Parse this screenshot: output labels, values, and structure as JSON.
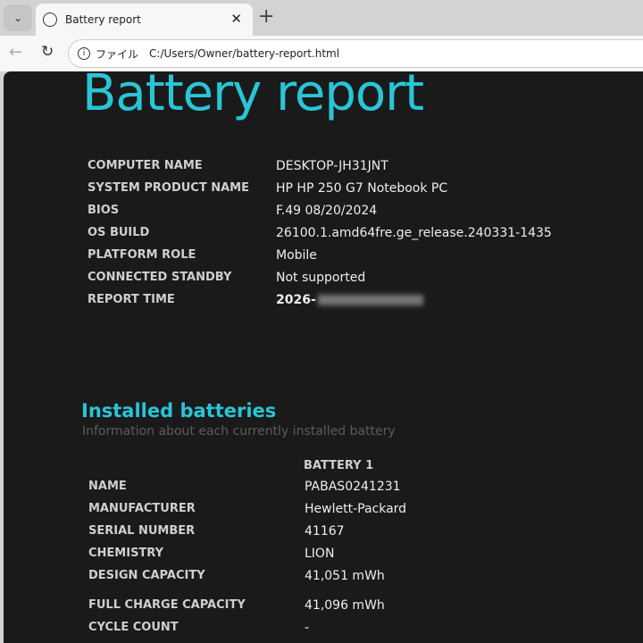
{
  "browser": {
    "tab_title": "Battery report",
    "scheme_label": "ファイル",
    "url": "C:/Users/Owner/battery-report.html"
  },
  "report": {
    "title": "Battery report",
    "system": [
      {
        "label": "COMPUTER NAME",
        "value": "DESKTOP-JH31JNT"
      },
      {
        "label": "SYSTEM PRODUCT NAME",
        "value": "HP HP 250 G7 Notebook PC"
      },
      {
        "label": "BIOS",
        "value": "F.49 08/20/2024"
      },
      {
        "label": "OS BUILD",
        "value": "26100.1.amd64fre.ge_release.240331-1435"
      },
      {
        "label": "PLATFORM ROLE",
        "value": "Mobile"
      },
      {
        "label": "CONNECTED STANDBY",
        "value": "Not supported"
      },
      {
        "label": "REPORT TIME",
        "value": "2026-"
      }
    ],
    "installed": {
      "title": "Installed batteries",
      "subtitle": "Information about each currently installed battery",
      "column": "BATTERY 1",
      "rows": [
        {
          "label": "NAME",
          "value": "PABAS0241231"
        },
        {
          "label": "MANUFACTURER",
          "value": "Hewlett-Packard"
        },
        {
          "label": "SERIAL NUMBER",
          "value": "41167"
        },
        {
          "label": "CHEMISTRY",
          "value": "LION"
        },
        {
          "label": "DESIGN CAPACITY",
          "value": "41,051 mWh"
        },
        {
          "label": "FULL CHARGE CAPACITY",
          "value": "41,096 mWh"
        },
        {
          "label": "CYCLE COUNT",
          "value": "-"
        }
      ]
    }
  }
}
